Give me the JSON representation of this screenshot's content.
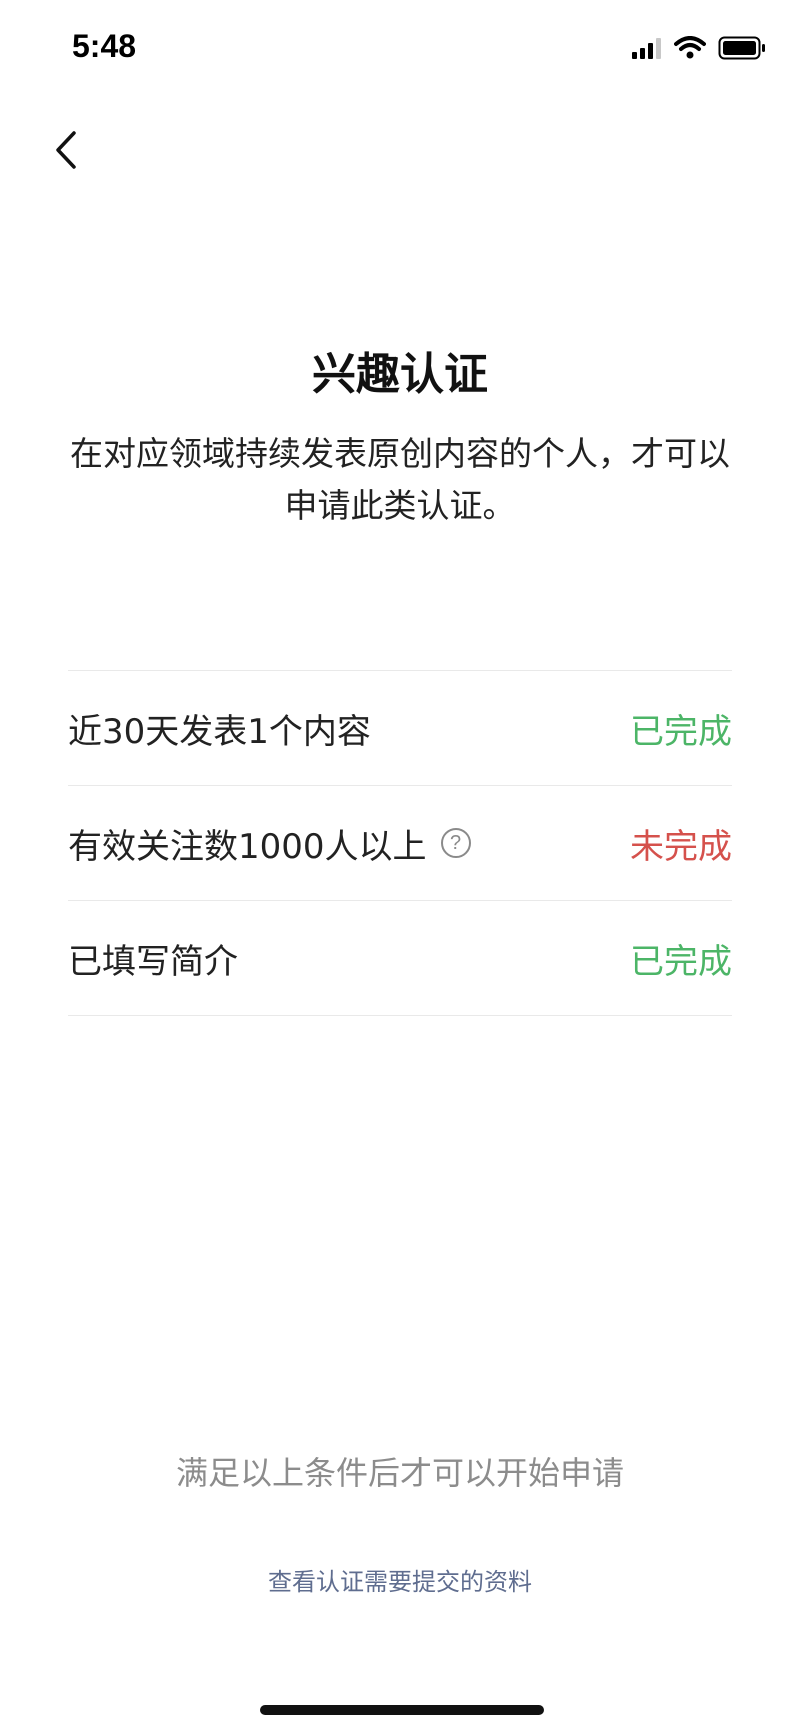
{
  "status_bar": {
    "time": "5:48"
  },
  "page": {
    "title": "兴趣认证",
    "description": "在对应领域持续发表原创内容的个人，才可以申请此类认证。"
  },
  "requirements": [
    {
      "label": "近30天发表1个内容",
      "status": "已完成"
    },
    {
      "label": "有效关注数1000人以上",
      "status": "未完成"
    },
    {
      "label": "已填写简介",
      "status": "已完成"
    }
  ],
  "footer": {
    "hint": "满足以上条件后才可以开始申请",
    "link": "查看认证需要提交的资料"
  },
  "colors": {
    "done": "#4cb567",
    "not_done": "#d5514c",
    "link": "#5f6d8f"
  },
  "icons": [
    "back-chevron-icon",
    "cellular-signal-icon",
    "wifi-icon",
    "battery-icon",
    "help-question-icon"
  ]
}
